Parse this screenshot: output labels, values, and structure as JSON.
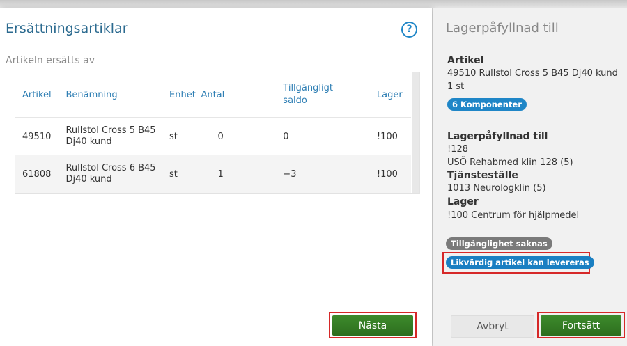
{
  "left": {
    "title": "Ersättningsartiklar",
    "help_label": "?",
    "subtitle": "Artikeln ersätts av",
    "columns": [
      "Artikel",
      "Benämning",
      "Enhet",
      "Antal",
      "Tillgängligt saldo",
      "Lager"
    ],
    "rows": [
      [
        "49510",
        "Rullstol Cross 5 B45 Dj40 kund",
        "st",
        "0",
        "0",
        "!100"
      ],
      [
        "61808",
        "Rullstol Cross 6 B45 Dj40 kund",
        "st",
        "1",
        "−3",
        "!100"
      ]
    ],
    "next_label": "Nästa"
  },
  "right": {
    "title": "Lagerpåfyllnad till",
    "article_heading": "Artikel",
    "article_name": "49510 Rullstol Cross 5 B45 Dj40 kund",
    "article_qty": "1 st",
    "components_badge": "6 Komponenter",
    "refill_heading": "Lagerpåfyllnad till",
    "refill_code": "!128",
    "refill_name": "USÖ Rehabmed klin 128 (5)",
    "service_heading": "Tjänsteställe",
    "service_name": "1013 Neurologklin (5)",
    "stock_heading": "Lager",
    "stock_name": "!100 Centrum för hjälpmedel",
    "badge_unavailable": "Tillgänglighet saknas",
    "badge_equivalent": "Likvärdig artikel kan levereras",
    "cancel_label": "Avbryt",
    "continue_label": "Fortsätt"
  },
  "colors": {
    "accent_blue": "#1f86c7",
    "button_green": "#3d8a2c",
    "highlight_red": "#d62828",
    "badge_gray": "#7a7a7a",
    "badge_blue": "#1a7fc2"
  }
}
